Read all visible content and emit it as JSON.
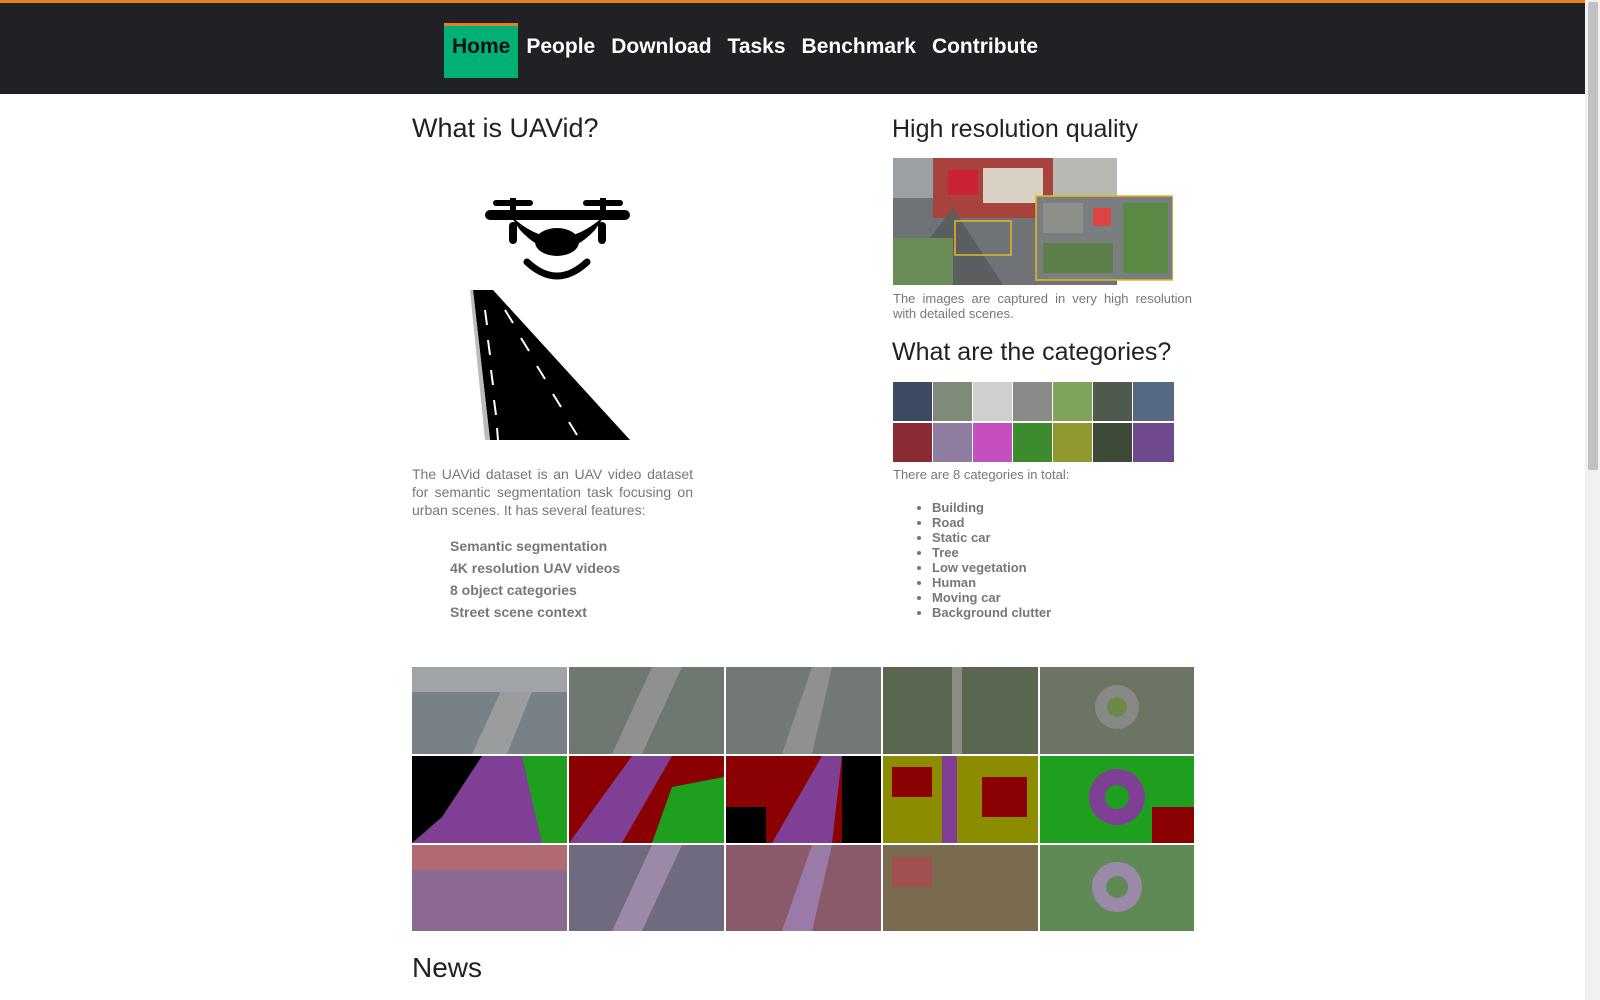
{
  "nav": {
    "items": [
      {
        "label": "Home",
        "active": true
      },
      {
        "label": "People"
      },
      {
        "label": "Download"
      },
      {
        "label": "Tasks"
      },
      {
        "label": "Benchmark"
      },
      {
        "label": "Contribute"
      }
    ]
  },
  "about": {
    "title": "What is UAVid?",
    "description": "The UAVid dataset is an UAV video dataset for semantic segmentation task focusing on urban scenes. It has several features:",
    "features": [
      "Semantic segmentation",
      "4K resolution UAV videos",
      "8 object categories",
      "Street scene context"
    ]
  },
  "resolution": {
    "title": "High resolution quality",
    "caption": "The images are captured in very high resolution with detailed scenes."
  },
  "categories": {
    "title": "What are the categories?",
    "intro": "There are 8 categories in total:",
    "items": [
      "Building",
      "Road",
      "Static car",
      "Tree",
      "Low vegetation",
      "Human",
      "Moving car",
      "Background clutter"
    ]
  },
  "news": {
    "title": "News"
  },
  "colors": {
    "accent": "#e67e22",
    "active_tab": "#00b074",
    "header_bg": "#1f2124",
    "seg_building": "#8b0000",
    "seg_road": "#7f3f95",
    "seg_tree": "#1ea01e",
    "seg_lowveg": "#8c8c00",
    "seg_car": "#c020c0",
    "seg_clutter": "#000000"
  }
}
